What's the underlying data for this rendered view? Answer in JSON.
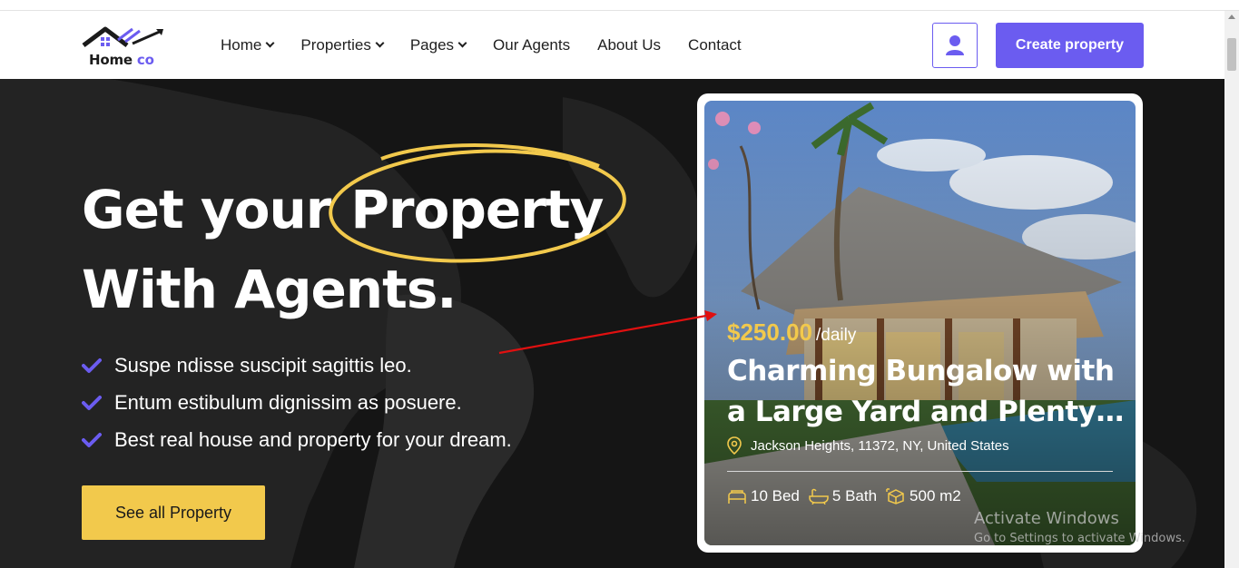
{
  "brand": {
    "name": "Home",
    "suffix": "co"
  },
  "nav": {
    "items": [
      {
        "label": "Home",
        "dropdown": true
      },
      {
        "label": "Properties",
        "dropdown": true
      },
      {
        "label": "Pages",
        "dropdown": true
      },
      {
        "label": "Our Agents",
        "dropdown": false
      },
      {
        "label": "About Us",
        "dropdown": false
      },
      {
        "label": "Contact",
        "dropdown": false
      }
    ],
    "account_icon": "user-icon",
    "create_label": "Create property"
  },
  "hero": {
    "title_part1": "Get your",
    "title_highlight": "Property",
    "title_line2": "With Agents.",
    "bullets": [
      "Suspe ndisse suscipit sagittis leo.",
      "Entum estibulum dignissim as posuere.",
      "Best real house and property for your dream."
    ],
    "cta_label": "See all Property"
  },
  "property": {
    "price": "$250.00",
    "period": "/daily",
    "title_line1": "Charming Bungalow with",
    "title_line2": "a Large Yard and Plenty…",
    "address": "Jackson Heights, 11372, NY, United States",
    "beds": "10 Bed",
    "baths": "5 Bath",
    "area": "500 m2"
  },
  "watermark": {
    "line1": "Activate Windows",
    "line2": "Go to Settings to activate Windows."
  },
  "colors": {
    "accent": "#6b5cf0",
    "highlight": "#f2c94c",
    "hero_bg": "#151515",
    "annotation_arrow": "#e01010"
  }
}
